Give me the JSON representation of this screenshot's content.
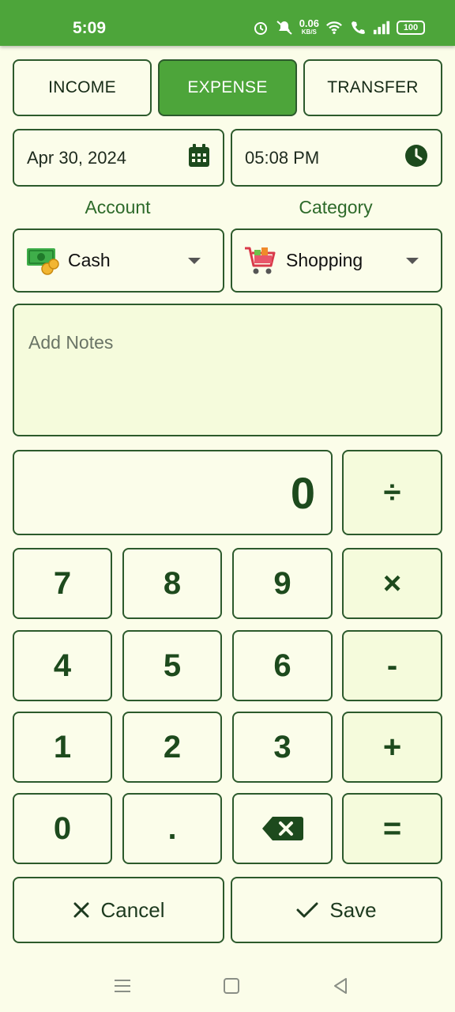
{
  "status_bar": {
    "time": "5:09",
    "net_speed": "0.06",
    "net_unit": "KB/S",
    "battery": "100"
  },
  "type_tabs": [
    {
      "label": "INCOME",
      "active": false
    },
    {
      "label": "EXPENSE",
      "active": true
    },
    {
      "label": "TRANSFER",
      "active": false
    }
  ],
  "date": {
    "value": "Apr 30, 2024",
    "icon": "calendar-icon"
  },
  "time": {
    "value": "05:08 PM",
    "icon": "clock-icon"
  },
  "account": {
    "label": "Account",
    "selected": "Cash",
    "icon": "cash-icon"
  },
  "category": {
    "label": "Category",
    "selected": "Shopping",
    "icon": "shopping-cart-icon"
  },
  "notes": {
    "placeholder": "Add Notes"
  },
  "calculator": {
    "display": "0",
    "keys": {
      "divide": "÷",
      "multiply": "×",
      "minus": "-",
      "plus": "+",
      "equals": "=",
      "d7": "7",
      "d8": "8",
      "d9": "9",
      "d4": "4",
      "d5": "5",
      "d6": "6",
      "d1": "1",
      "d2": "2",
      "d3": "3",
      "d0": "0",
      "dot": "."
    }
  },
  "actions": {
    "cancel": "Cancel",
    "save": "Save"
  },
  "colors": {
    "accent": "#4da53a",
    "background": "#fbfde9",
    "border": "#2c5a2c",
    "text": "#1d4a1d"
  }
}
